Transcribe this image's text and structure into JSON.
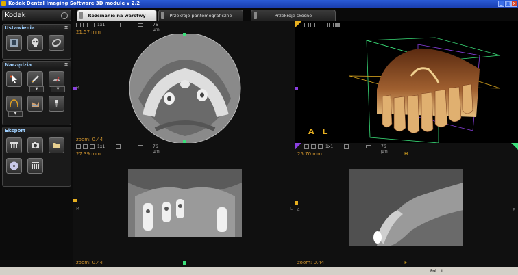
{
  "window": {
    "title": "Kodak Dental Imaging Software 3D module v 2.2",
    "minimize": "_",
    "maximize": "□",
    "close": "x"
  },
  "sidebar": {
    "brand": "Kodak",
    "settings": {
      "title": "Ustawienia",
      "pin": "¥"
    },
    "tools": {
      "title": "Narzędzia",
      "pin": "¥"
    },
    "export": {
      "title": "Eksport"
    }
  },
  "tabs": [
    {
      "label": "Rozcinanie na warstwy ortogo..."
    },
    {
      "label": "Przekroje pantomograficzne"
    },
    {
      "label": "Przekroje skośne"
    }
  ],
  "viewports": {
    "axial": {
      "measure": "21.57 mm",
      "zoom": "zoom: 0.44",
      "ratio": "1x1",
      "slice": "76 µm",
      "left_label": "R"
    },
    "volume": {
      "ratio": "1x1",
      "slice": "76 µm",
      "orient": "A L",
      "left_label": "L"
    },
    "coronal": {
      "measure": "27.39 mm",
      "zoom": "zoom: 0.44",
      "ratio": "1x1",
      "slice": "76 µm",
      "left_label": "R",
      "right_label": "L"
    },
    "sagittal": {
      "measure": "25.70 mm",
      "zoom": "zoom: 0.44",
      "left_label": "A",
      "right_label": "P",
      "top_label": "H",
      "bottom_label": "F"
    }
  },
  "status": {
    "text": "Pol",
    "mode": "I"
  },
  "colors": {
    "accent_orange": "#d0942e",
    "marker_purple": "#8a3fe0",
    "marker_green": "#3be07a",
    "marker_yellow": "#e8b020"
  }
}
